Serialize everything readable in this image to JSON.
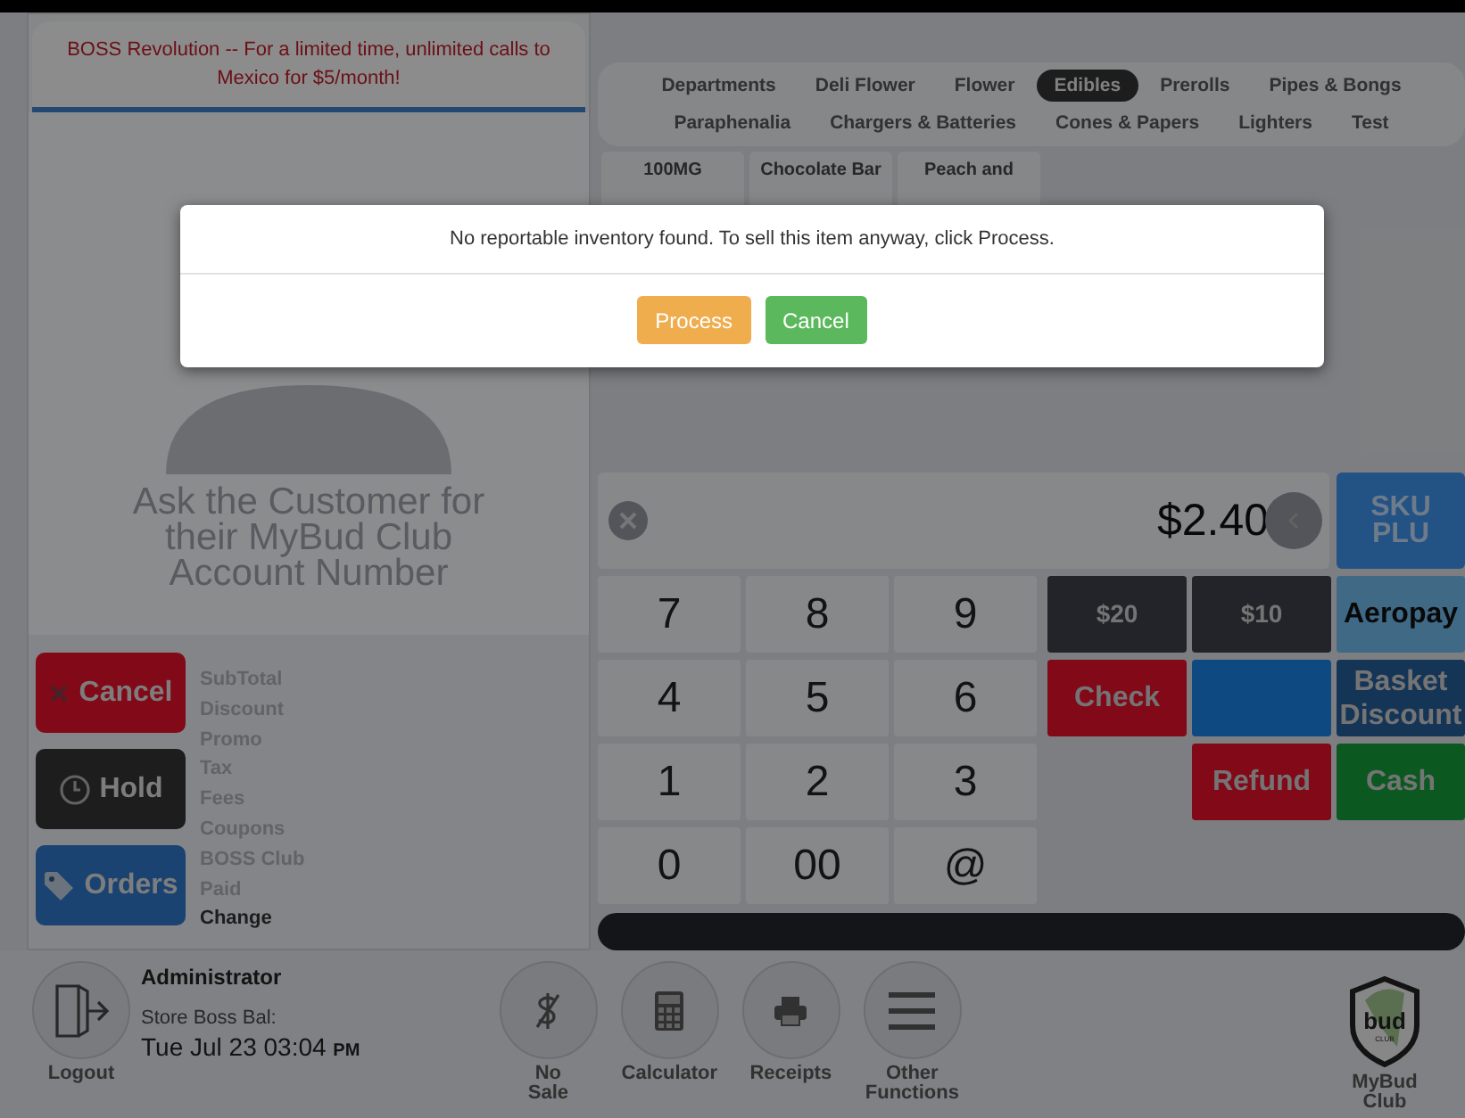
{
  "banner": {
    "text": "BOSS Revolution -- For a limited time, unlimited calls to Mexico for $5/month!"
  },
  "customer_prompt": "Ask the Customer for their MyBud Club Account Number",
  "categories": [
    {
      "label": "Departments",
      "selected": false
    },
    {
      "label": "Deli Flower",
      "selected": false
    },
    {
      "label": "Flower",
      "selected": false
    },
    {
      "label": "Edibles",
      "selected": true
    },
    {
      "label": "Prerolls",
      "selected": false
    },
    {
      "label": "Pipes & Bongs",
      "selected": false
    },
    {
      "label": "Paraphenalia",
      "selected": false
    },
    {
      "label": "Chargers & Batteries",
      "selected": false
    },
    {
      "label": "Cones & Papers",
      "selected": false
    },
    {
      "label": "Lighters",
      "selected": false
    },
    {
      "label": "Test",
      "selected": false
    }
  ],
  "products": [
    {
      "name": "100MG"
    },
    {
      "name": "Chocolate Bar"
    },
    {
      "name": "Peach and"
    }
  ],
  "amount": "$2.40",
  "sku_button": "SKU PLU",
  "keypad": [
    "7",
    "8",
    "9",
    "4",
    "5",
    "6",
    "1",
    "2",
    "3",
    "0",
    "00",
    "@"
  ],
  "payment_rows": [
    [
      {
        "label": "$20",
        "kind": "dark"
      },
      {
        "label": "$10",
        "kind": "dark"
      },
      {
        "label": "Aeropay",
        "kind": "light"
      }
    ],
    [
      {
        "label": "Check",
        "kind": "red"
      },
      {
        "kind": "blue"
      },
      {
        "label": "Basket Discount",
        "kind": "navy"
      }
    ],
    [
      {
        "label": "Refund",
        "kind": "red"
      },
      {
        "label": "Cash",
        "kind": "green"
      }
    ]
  ],
  "action_buttons": [
    {
      "label": "Cancel",
      "kind": "cancel"
    },
    {
      "label": "Hold",
      "kind": "hold"
    },
    {
      "label": "Orders",
      "kind": "orders"
    }
  ],
  "totals": [
    {
      "label": "SubTotal",
      "strong": false
    },
    {
      "label": "Discount",
      "strong": false
    },
    {
      "label": "Promo",
      "strong": false
    },
    {
      "label": "Tax",
      "strong": false
    },
    {
      "label": "Fees",
      "strong": false
    },
    {
      "label": "Coupons",
      "strong": false
    },
    {
      "label": "BOSS Club",
      "strong": false
    },
    {
      "label": "Paid",
      "strong": false
    },
    {
      "label": "Change",
      "strong": true
    }
  ],
  "footer": {
    "logout": "Logout",
    "user": "Administrator",
    "balance_label": "Store Boss Bal:",
    "date": "Tue Jul 23 03:04",
    "meridiem": "PM",
    "tools": [
      {
        "label": "No Sale",
        "kind": "no-sale"
      },
      {
        "label": "Calculator",
        "kind": "calculator"
      },
      {
        "label": "Receipts",
        "kind": "receipts"
      },
      {
        "label": "Other Functions",
        "kind": "menu"
      }
    ],
    "brand": {
      "label": "MyBud Club",
      "logo_text": "bud",
      "logo_sub": "CLUB"
    }
  },
  "dialog": {
    "message": "No reportable inventory found. To sell this item anyway, click Process.",
    "buttons": [
      {
        "label": "Process",
        "kind": "warning"
      },
      {
        "label": "Cancel",
        "kind": "success"
      }
    ]
  }
}
